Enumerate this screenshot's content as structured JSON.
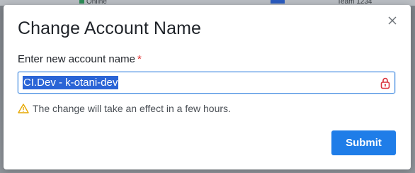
{
  "background": {
    "status_text": "Online",
    "right_text": "Team 1234"
  },
  "modal": {
    "title": "Change Account Name",
    "close_icon": "close-icon",
    "field": {
      "label": "Enter new account name",
      "required_marker": "*",
      "value": "CI.Dev - k-otani-dev",
      "trailing_icon": "lock-icon"
    },
    "hint": {
      "icon": "warning-icon",
      "text": "The change will take an effect in a few hours."
    },
    "submit_label": "Submit"
  },
  "colors": {
    "accent": "#1f7de8",
    "selection": "#2a64d6",
    "required": "#e03131",
    "warning": "#e6a700",
    "lock": "#d9303a"
  }
}
